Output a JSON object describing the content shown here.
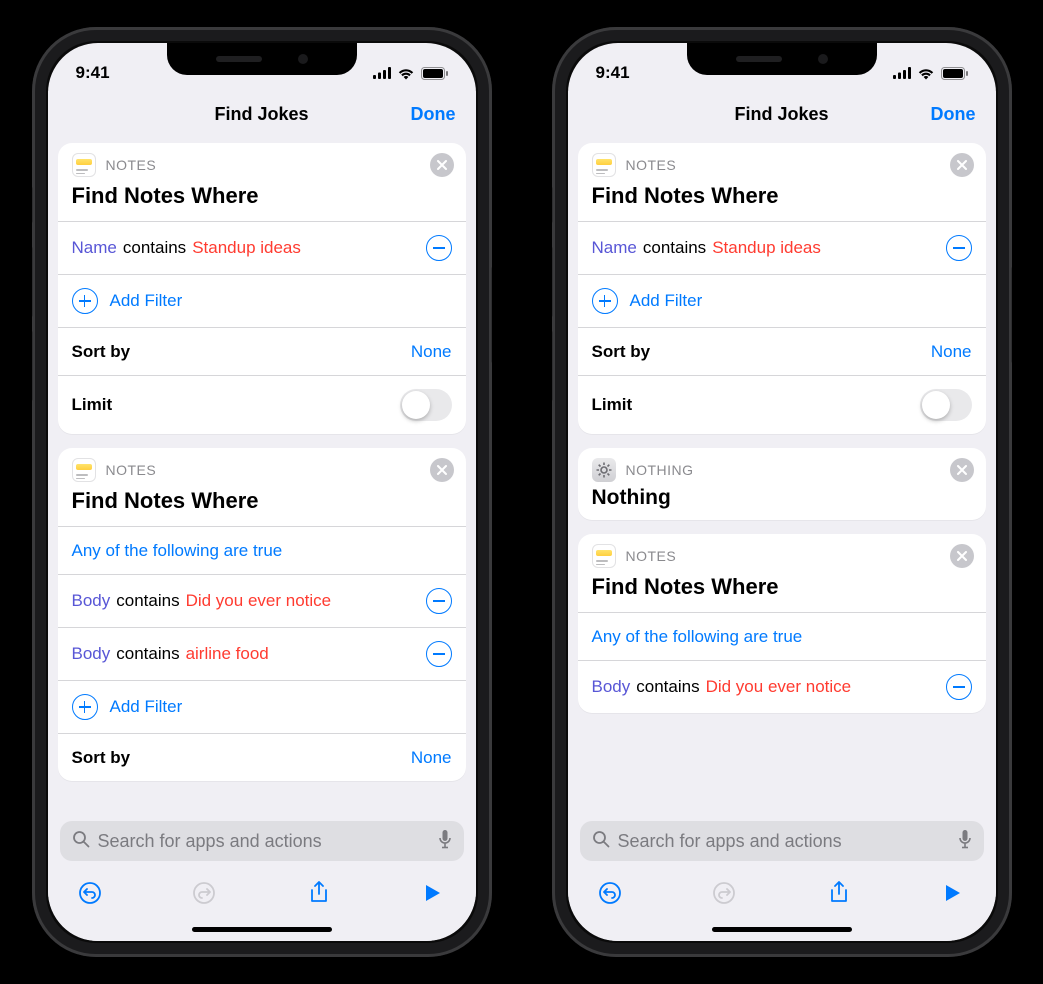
{
  "status": {
    "time": "9:41"
  },
  "nav": {
    "title": "Find Jokes",
    "done": "Done"
  },
  "labels": {
    "notes_app": "NOTES",
    "nothing_app": "NOTHING",
    "find_notes_where": "Find Notes Where",
    "nothing_title": "Nothing",
    "add_filter": "Add Filter",
    "sort_by": "Sort by",
    "sort_value": "None",
    "limit": "Limit",
    "any_true": "Any of the following are true"
  },
  "filters": {
    "name": "Name",
    "body": "Body",
    "contains": "contains",
    "standup": "Standup ideas",
    "notice": "Did you ever notice",
    "airline": "airline food"
  },
  "search": {
    "placeholder": "Search for apps and actions"
  }
}
